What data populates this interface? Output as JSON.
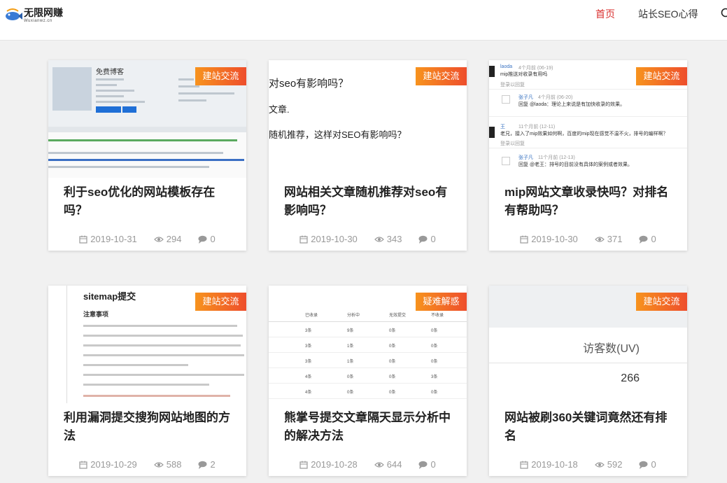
{
  "header": {
    "logo_title": "无限网赚",
    "logo_sub": "Wuxianwz.cn",
    "nav": [
      {
        "label": "首页",
        "active": true
      },
      {
        "label": "站长SEO心得",
        "active": false
      }
    ],
    "accent_color": "#d9302f"
  },
  "cards": [
    {
      "badge": "建站交流",
      "title": "利于seo优化的网站模板存在吗？",
      "date": "2019-10-31",
      "views": "294",
      "comments": "0",
      "thumb": {
        "title": "免费博客"
      }
    },
    {
      "badge": "建站交流",
      "title": "网站相关文章随机推荐对seo有影响吗？",
      "date": "2019-10-30",
      "views": "343",
      "comments": "0",
      "thumb": {
        "lines": [
          "对seo有影响吗？",
          "文章.",
          "随机推荐，这样对SEO有影响吗？"
        ]
      }
    },
    {
      "badge": "建站交流",
      "title": "mip网站文章收录快吗？对排名有帮助吗？",
      "date": "2019-10-30",
      "views": "371",
      "comments": "0",
      "thumb": {
        "c1_user": "laoda",
        "c1_time": "4个月前 (06-19)",
        "c1_text": "mip推送对收录有用吗",
        "reply": "登录以回复",
        "login_reply": "登录以回复",
        "c2_user": "张子凡",
        "c2_time": "4个月前 (06-20)",
        "c2_text": "回复 @laoda：理论上来说是有加快收录的效果。",
        "c3_user": "王",
        "c3_time": "11个月前 (12-11)",
        "c3_text": "老兄，接入了mip效果如何啊，百度的mip现在感觉不温不火，排号的编样啊？",
        "c4_user": "张子凡",
        "c4_time": "11个月前 (12-13)",
        "c4_text": "回复 @老王：排号的目前没有具体的案例或者效果。"
      }
    },
    {
      "badge": "建站交流",
      "title": "利用漏洞提交搜狗网站地图的方法",
      "date": "2019-10-29",
      "views": "588",
      "comments": "2",
      "thumb": {
        "heading": "sitemap提交",
        "note": "注意事项"
      }
    },
    {
      "badge": "疑难解惑",
      "title": "熊掌号提交文章隔天显示分析中的解决方法",
      "date": "2019-10-28",
      "views": "644",
      "comments": "0",
      "thumb": {
        "headers": [
          "已收录",
          "分析中",
          "无效提交",
          "不收录"
        ],
        "rows": [
          [
            "3条",
            "9条",
            "0条",
            "0条"
          ],
          [
            "3条",
            "1条",
            "0条",
            "0条"
          ],
          [
            "3条",
            "1条",
            "0条",
            "0条"
          ],
          [
            "4条",
            "0条",
            "0条",
            "3条"
          ],
          [
            "4条",
            "0条",
            "0条",
            "0条"
          ]
        ]
      }
    },
    {
      "badge": "建站交流",
      "title": "网站被刷360关键词竟然还有排名",
      "date": "2019-10-18",
      "views": "592",
      "comments": "0",
      "thumb": {
        "label": "访客数(UV)",
        "value": "266"
      }
    }
  ]
}
